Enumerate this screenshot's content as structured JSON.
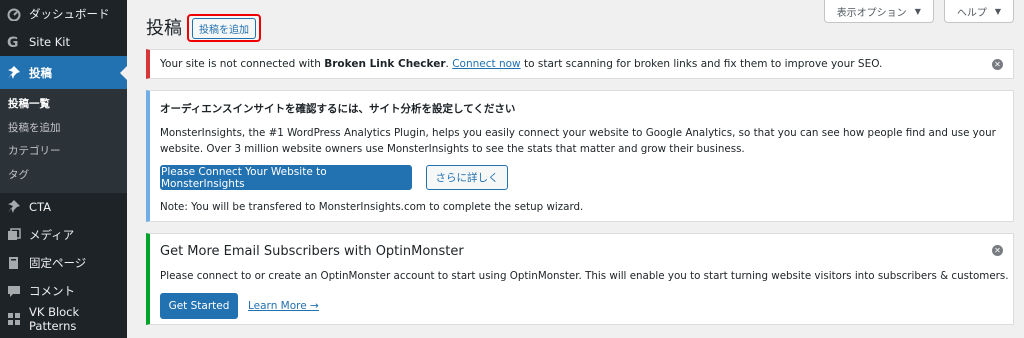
{
  "sidebar": {
    "items": [
      {
        "label": "ダッシュボード",
        "icon": "dashboard-icon"
      },
      {
        "label": "Site Kit",
        "icon": "site-kit-icon"
      },
      {
        "label": "投稿",
        "icon": "pin-icon",
        "current": true
      },
      {
        "label": "CTA",
        "icon": "pin-icon"
      },
      {
        "label": "メディア",
        "icon": "media-icon"
      },
      {
        "label": "固定ページ",
        "icon": "page-icon"
      },
      {
        "label": "コメント",
        "icon": "comment-icon"
      },
      {
        "label": "VK Block Patterns",
        "icon": "grid-icon"
      }
    ],
    "submenu": [
      "投稿一覧",
      "投稿を追加",
      "カテゴリー",
      "タグ"
    ]
  },
  "header": {
    "title": "投稿",
    "add_new": "投稿を追加",
    "screen_options": "表示オプション",
    "help": "ヘルプ"
  },
  "notice_error": {
    "pre": "Your site is not connected with ",
    "strong": "Broken Link Checker",
    "mid": ". ",
    "link": "Connect now",
    "post": " to start scanning for broken links and fix them to improve your SEO."
  },
  "notice_info": {
    "title": "オーディエンスインサイトを確認するには、サイト分析を設定してください",
    "desc": "MonsterInsights, the #1 WordPress Analytics Plugin, helps you easily connect your website to Google Analytics, so that you can see how people find and use your website. Over 3 million website owners use MonsterInsights to see the stats that matter and grow their business.",
    "connect_button": "Please Connect Your Website to MonsterInsights",
    "learn_button": "さらに詳しく",
    "note": "Note: You will be transfered to MonsterInsights.com to complete the setup wizard."
  },
  "notice_optin": {
    "title": "Get More Email Subscribers with OptinMonster",
    "desc": "Please connect to or create an OptinMonster account to start using OptinMonster. This will enable you to start turning website visitors into subscribers & customers.",
    "start_button": "Get Started",
    "learn_more": "Learn More →"
  },
  "colors": {
    "sidebar_bg": "#1d2327",
    "accent": "#2271b1",
    "error": "#d63638",
    "info": "#72aee6",
    "success": "#00a32a",
    "highlight_box": "#ee0000"
  }
}
